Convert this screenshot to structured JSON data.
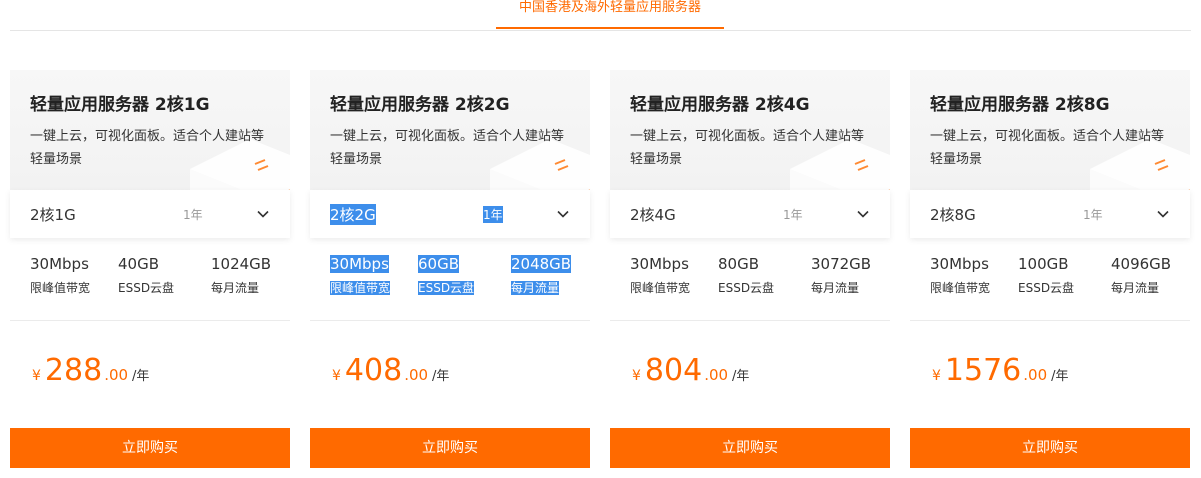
{
  "tab": {
    "label": "中国香港及海外轻量应用服务器"
  },
  "cards": [
    {
      "title": "轻量应用服务器 2核1G",
      "desc": "一键上云，可视化面板。适合个人建站等轻量场景",
      "select": {
        "value": "2核1G",
        "term": "1年"
      },
      "specs": [
        {
          "value": "30Mbps",
          "label": "限峰值带宽"
        },
        {
          "value": "40GB",
          "label": "ESSD云盘"
        },
        {
          "value": "1024GB",
          "label": "每月流量"
        }
      ],
      "price": {
        "currency": "¥",
        "integer": "288",
        "decimal": ".00",
        "unit": "/年"
      },
      "buy_label": "立即购买"
    },
    {
      "title": "轻量应用服务器 2核2G",
      "desc": "一键上云，可视化面板。适合个人建站等轻量场景",
      "select": {
        "value": "2核2G",
        "term": "1年"
      },
      "specs": [
        {
          "value": "30Mbps",
          "label": "限峰值带宽"
        },
        {
          "value": "60GB",
          "label": "ESSD云盘"
        },
        {
          "value": "2048GB",
          "label": "每月流量"
        }
      ],
      "price": {
        "currency": "¥",
        "integer": "408",
        "decimal": ".00",
        "unit": "/年"
      },
      "buy_label": "立即购买"
    },
    {
      "title": "轻量应用服务器 2核4G",
      "desc": "一键上云，可视化面板。适合个人建站等轻量场景",
      "select": {
        "value": "2核4G",
        "term": "1年"
      },
      "specs": [
        {
          "value": "30Mbps",
          "label": "限峰值带宽"
        },
        {
          "value": "80GB",
          "label": "ESSD云盘"
        },
        {
          "value": "3072GB",
          "label": "每月流量"
        }
      ],
      "price": {
        "currency": "¥",
        "integer": "804",
        "decimal": ".00",
        "unit": "/年"
      },
      "buy_label": "立即购买"
    },
    {
      "title": "轻量应用服务器 2核8G",
      "desc": "一键上云，可视化面板。适合个人建站等轻量场景",
      "select": {
        "value": "2核8G",
        "term": "1年"
      },
      "specs": [
        {
          "value": "30Mbps",
          "label": "限峰值带宽"
        },
        {
          "value": "100GB",
          "label": "ESSD云盘"
        },
        {
          "value": "4096GB",
          "label": "每月流量"
        }
      ],
      "price": {
        "currency": "¥",
        "integer": "1576",
        "decimal": ".00",
        "unit": "/年"
      },
      "buy_label": "立即购买"
    }
  ],
  "colors": {
    "accent": "#ff6a00",
    "selection": "#3d8eeb"
  },
  "icons": {
    "dropdown": "chevron-down-icon",
    "product_image": "server-box-illustration"
  }
}
